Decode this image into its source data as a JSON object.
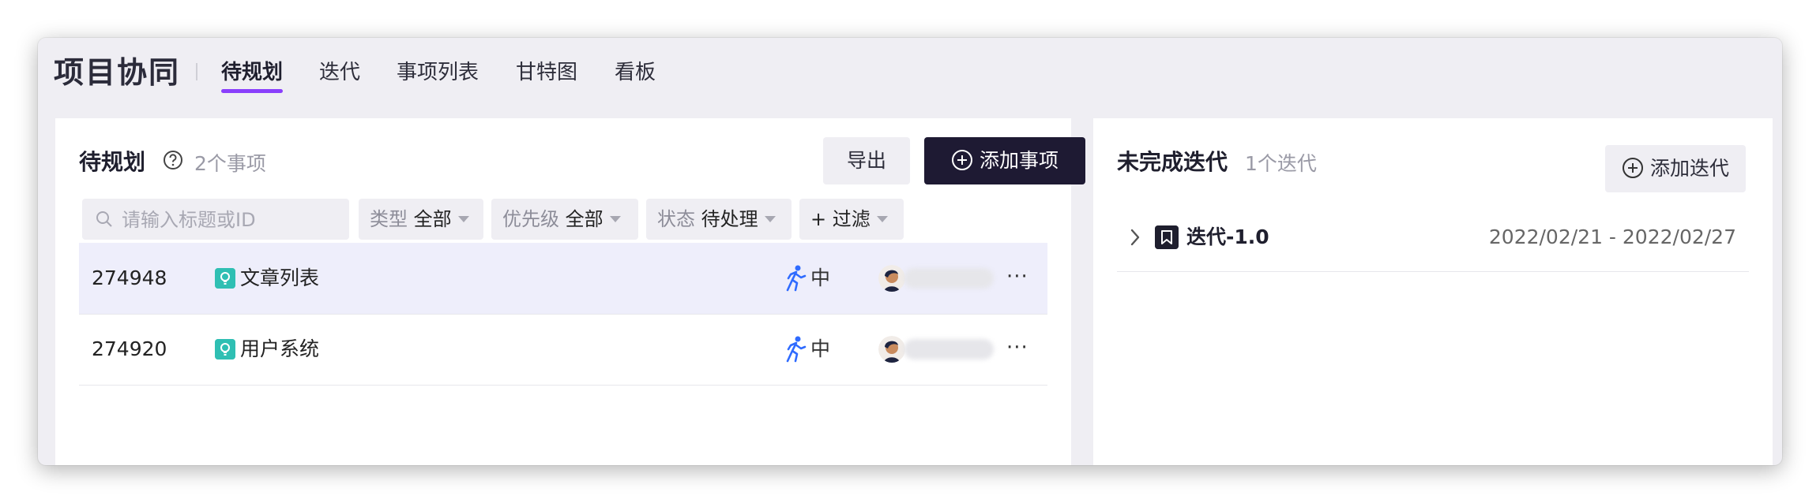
{
  "app": {
    "title": "项目协同"
  },
  "tabs": [
    {
      "label": "待规划",
      "active": true
    },
    {
      "label": "迭代",
      "active": false
    },
    {
      "label": "事项列表",
      "active": false
    },
    {
      "label": "甘特图",
      "active": false
    },
    {
      "label": "看板",
      "active": false
    }
  ],
  "backlog": {
    "title": "待规划",
    "count": "2个事项",
    "export_label": "导出",
    "add_label": "添加事项",
    "search": {
      "placeholder": "请输入标题或ID",
      "value": ""
    },
    "filters": [
      {
        "label": "类型",
        "value": "全部"
      },
      {
        "label": "优先级",
        "value": "全部"
      },
      {
        "label": "状态",
        "value": "待处理"
      }
    ],
    "more_filter_label": "+ 过滤",
    "rows": [
      {
        "id": "274948",
        "title": "文章列表",
        "priority": "中",
        "more": "···"
      },
      {
        "id": "274920",
        "title": "用户系统",
        "priority": "中",
        "more": "···"
      }
    ]
  },
  "iterations": {
    "title": "未完成迭代",
    "count": "1个迭代",
    "add_label": "添加迭代",
    "items": [
      {
        "name": "迭代-1.0",
        "dates": "2022/02/21 - 2022/02/27"
      }
    ]
  },
  "colors": {
    "accent": "#8a3ffc",
    "dark_button": "#1e1a33",
    "type_icon": "#2fbfb3",
    "priority_icon": "#2f6bff"
  },
  "icons": [
    "help-icon",
    "plus-circle-icon",
    "search-icon",
    "caret-down-icon",
    "requirement-icon",
    "run-priority-icon",
    "avatar",
    "more-icon",
    "chevron-right-icon",
    "bookmark-icon"
  ]
}
